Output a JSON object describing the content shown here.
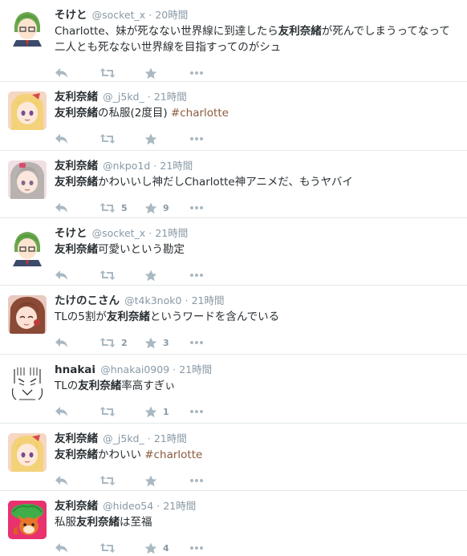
{
  "tweets": [
    {
      "name": "そけと",
      "screen": "@socket_x",
      "sep": "·",
      "time": "20時間",
      "t1": "Charlotte、妹が死なない世界線に到達したら",
      "b1": "友利奈緒",
      "t2": "が死んでしまうってなって二人とも死なない世界線を目指すってのがシュ",
      "retweets": "",
      "favorites": "",
      "avatar": "green-hair-boy"
    },
    {
      "name": "友利奈緒",
      "screen": "@_j5kd_",
      "sep": "·",
      "time": "21時間",
      "b0": "友利奈緒",
      "t1": "の私服(2度目) ",
      "hashtag": "#charlotte",
      "retweets": "",
      "favorites": "",
      "avatar": "blonde-girl"
    },
    {
      "name": "友利奈緒",
      "screen": "@nkpo1d",
      "sep": "·",
      "time": "21時間",
      "b0": "友利奈緒",
      "t1": "かわいいし神だしCharlotte神アニメだ、もうヤバイ",
      "retweets": "5",
      "favorites": "9",
      "avatar": "silver-hair-girl"
    },
    {
      "name": "そけと",
      "screen": "@socket_x",
      "sep": "·",
      "time": "21時間",
      "b0": "友利奈緒",
      "t1": "可愛いという勘定",
      "retweets": "",
      "favorites": "",
      "avatar": "green-hair-boy"
    },
    {
      "name": "たけのこさん",
      "screen": "@t4k3nok0",
      "sep": "·",
      "time": "21時間",
      "t1": "TLの5割が",
      "b1": "友利奈緒",
      "t2": "というワードを含んでいる",
      "retweets": "2",
      "favorites": "3",
      "avatar": "brown-hair-girl"
    },
    {
      "name": "hnakai",
      "screen": "@hnakai0909",
      "sep": "·",
      "time": "21時間",
      "t1": "TLの",
      "b1": "友利奈緒",
      "t2": "率高すぎぃ",
      "retweets": "",
      "favorites": "1",
      "avatar": "sketch-face"
    },
    {
      "name": "友利奈緒",
      "screen": "@_j5kd_",
      "sep": "·",
      "time": "21時間",
      "b0": "友利奈緒",
      "t1": "かわいい ",
      "hashtag": "#charlotte",
      "retweets": "",
      "favorites": "",
      "avatar": "blonde-girl"
    },
    {
      "name": "友利奈緒",
      "screen": "@hideo54",
      "sep": "·",
      "time": "21時間",
      "t1": "私服",
      "b1": "友利奈緒",
      "t2": "は至福",
      "retweets": "",
      "favorites": "4",
      "avatar": "fox-mascot"
    }
  ],
  "colors": {
    "text": "#292f33",
    "muted": "#8899a6",
    "icon": "#aab8c2",
    "hashtag": "#8b5a3c",
    "divider": "#e1e8ed"
  },
  "icons": {
    "reply": "reply-icon",
    "retweet": "retweet-icon",
    "favorite": "star-icon",
    "more": "more-icon"
  }
}
